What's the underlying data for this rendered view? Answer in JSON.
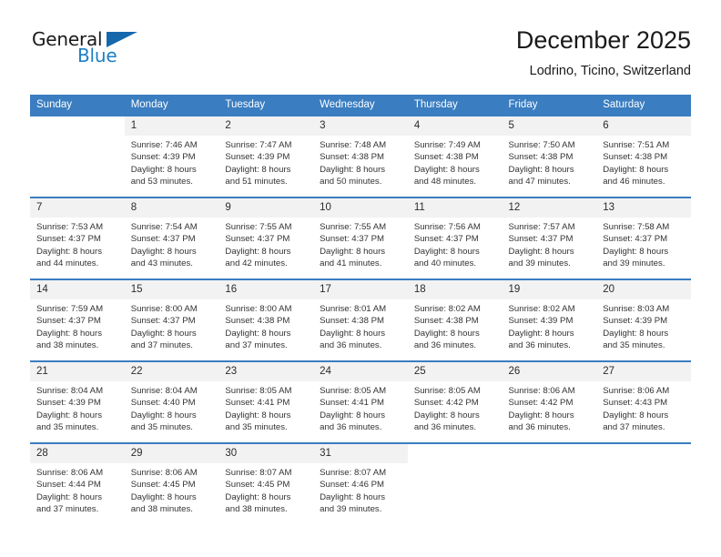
{
  "brand": {
    "name_part1": "General",
    "name_part2": "Blue"
  },
  "header": {
    "title": "December 2025",
    "subtitle": "Lodrino, Ticino, Switzerland"
  },
  "colors": {
    "header_blue": "#3a7dc0",
    "brand_blue": "#1f7fc4",
    "daynum_bg": "#f2f2f2"
  },
  "weekdays": [
    "Sunday",
    "Monday",
    "Tuesday",
    "Wednesday",
    "Thursday",
    "Friday",
    "Saturday"
  ],
  "weeks": [
    [
      {
        "day": "",
        "info": ""
      },
      {
        "day": "1",
        "info": "Sunrise: 7:46 AM\nSunset: 4:39 PM\nDaylight: 8 hours\nand 53 minutes."
      },
      {
        "day": "2",
        "info": "Sunrise: 7:47 AM\nSunset: 4:39 PM\nDaylight: 8 hours\nand 51 minutes."
      },
      {
        "day": "3",
        "info": "Sunrise: 7:48 AM\nSunset: 4:38 PM\nDaylight: 8 hours\nand 50 minutes."
      },
      {
        "day": "4",
        "info": "Sunrise: 7:49 AM\nSunset: 4:38 PM\nDaylight: 8 hours\nand 48 minutes."
      },
      {
        "day": "5",
        "info": "Sunrise: 7:50 AM\nSunset: 4:38 PM\nDaylight: 8 hours\nand 47 minutes."
      },
      {
        "day": "6",
        "info": "Sunrise: 7:51 AM\nSunset: 4:38 PM\nDaylight: 8 hours\nand 46 minutes."
      }
    ],
    [
      {
        "day": "7",
        "info": "Sunrise: 7:53 AM\nSunset: 4:37 PM\nDaylight: 8 hours\nand 44 minutes."
      },
      {
        "day": "8",
        "info": "Sunrise: 7:54 AM\nSunset: 4:37 PM\nDaylight: 8 hours\nand 43 minutes."
      },
      {
        "day": "9",
        "info": "Sunrise: 7:55 AM\nSunset: 4:37 PM\nDaylight: 8 hours\nand 42 minutes."
      },
      {
        "day": "10",
        "info": "Sunrise: 7:55 AM\nSunset: 4:37 PM\nDaylight: 8 hours\nand 41 minutes."
      },
      {
        "day": "11",
        "info": "Sunrise: 7:56 AM\nSunset: 4:37 PM\nDaylight: 8 hours\nand 40 minutes."
      },
      {
        "day": "12",
        "info": "Sunrise: 7:57 AM\nSunset: 4:37 PM\nDaylight: 8 hours\nand 39 minutes."
      },
      {
        "day": "13",
        "info": "Sunrise: 7:58 AM\nSunset: 4:37 PM\nDaylight: 8 hours\nand 39 minutes."
      }
    ],
    [
      {
        "day": "14",
        "info": "Sunrise: 7:59 AM\nSunset: 4:37 PM\nDaylight: 8 hours\nand 38 minutes."
      },
      {
        "day": "15",
        "info": "Sunrise: 8:00 AM\nSunset: 4:37 PM\nDaylight: 8 hours\nand 37 minutes."
      },
      {
        "day": "16",
        "info": "Sunrise: 8:00 AM\nSunset: 4:38 PM\nDaylight: 8 hours\nand 37 minutes."
      },
      {
        "day": "17",
        "info": "Sunrise: 8:01 AM\nSunset: 4:38 PM\nDaylight: 8 hours\nand 36 minutes."
      },
      {
        "day": "18",
        "info": "Sunrise: 8:02 AM\nSunset: 4:38 PM\nDaylight: 8 hours\nand 36 minutes."
      },
      {
        "day": "19",
        "info": "Sunrise: 8:02 AM\nSunset: 4:39 PM\nDaylight: 8 hours\nand 36 minutes."
      },
      {
        "day": "20",
        "info": "Sunrise: 8:03 AM\nSunset: 4:39 PM\nDaylight: 8 hours\nand 35 minutes."
      }
    ],
    [
      {
        "day": "21",
        "info": "Sunrise: 8:04 AM\nSunset: 4:39 PM\nDaylight: 8 hours\nand 35 minutes."
      },
      {
        "day": "22",
        "info": "Sunrise: 8:04 AM\nSunset: 4:40 PM\nDaylight: 8 hours\nand 35 minutes."
      },
      {
        "day": "23",
        "info": "Sunrise: 8:05 AM\nSunset: 4:41 PM\nDaylight: 8 hours\nand 35 minutes."
      },
      {
        "day": "24",
        "info": "Sunrise: 8:05 AM\nSunset: 4:41 PM\nDaylight: 8 hours\nand 36 minutes."
      },
      {
        "day": "25",
        "info": "Sunrise: 8:05 AM\nSunset: 4:42 PM\nDaylight: 8 hours\nand 36 minutes."
      },
      {
        "day": "26",
        "info": "Sunrise: 8:06 AM\nSunset: 4:42 PM\nDaylight: 8 hours\nand 36 minutes."
      },
      {
        "day": "27",
        "info": "Sunrise: 8:06 AM\nSunset: 4:43 PM\nDaylight: 8 hours\nand 37 minutes."
      }
    ],
    [
      {
        "day": "28",
        "info": "Sunrise: 8:06 AM\nSunset: 4:44 PM\nDaylight: 8 hours\nand 37 minutes."
      },
      {
        "day": "29",
        "info": "Sunrise: 8:06 AM\nSunset: 4:45 PM\nDaylight: 8 hours\nand 38 minutes."
      },
      {
        "day": "30",
        "info": "Sunrise: 8:07 AM\nSunset: 4:45 PM\nDaylight: 8 hours\nand 38 minutes."
      },
      {
        "day": "31",
        "info": "Sunrise: 8:07 AM\nSunset: 4:46 PM\nDaylight: 8 hours\nand 39 minutes."
      },
      {
        "day": "",
        "info": ""
      },
      {
        "day": "",
        "info": ""
      },
      {
        "day": "",
        "info": ""
      }
    ]
  ]
}
